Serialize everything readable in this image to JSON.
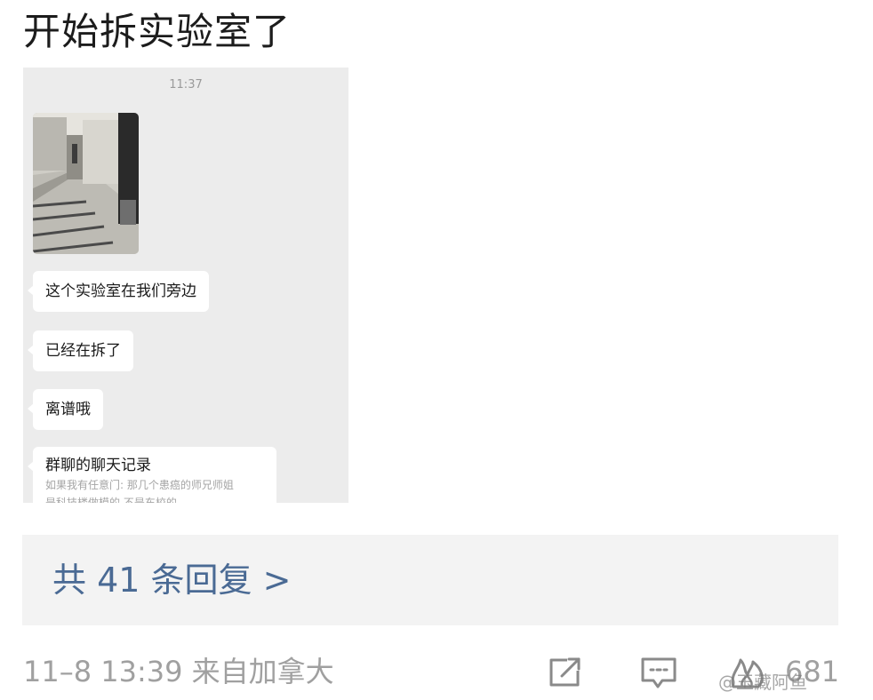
{
  "post": {
    "title": "开始拆实验室了"
  },
  "chat": {
    "time": "11:37",
    "messages": [
      "这个实验室在我们旁边",
      "已经在拆了",
      "离谱哦"
    ],
    "chat_record": {
      "title": "群聊的聊天记录",
      "line1": "如果我有任意门: 那几个患癌的师兄师姐",
      "line2": "是科技楼做模的 不是东校的"
    }
  },
  "replies": {
    "label": "共 41 条回复 >"
  },
  "meta": {
    "time_source": "11–8 13:39 来自加拿大",
    "like_count": "681"
  },
  "watermark": {
    "text": "@玉藏阿鱼"
  },
  "icons": {
    "share": "share-icon",
    "comment": "comment-icon",
    "like": "like-icon"
  },
  "colors": {
    "link": "#4a6a94",
    "meta": "#a0a0a0",
    "chat_bg": "#ececec"
  }
}
